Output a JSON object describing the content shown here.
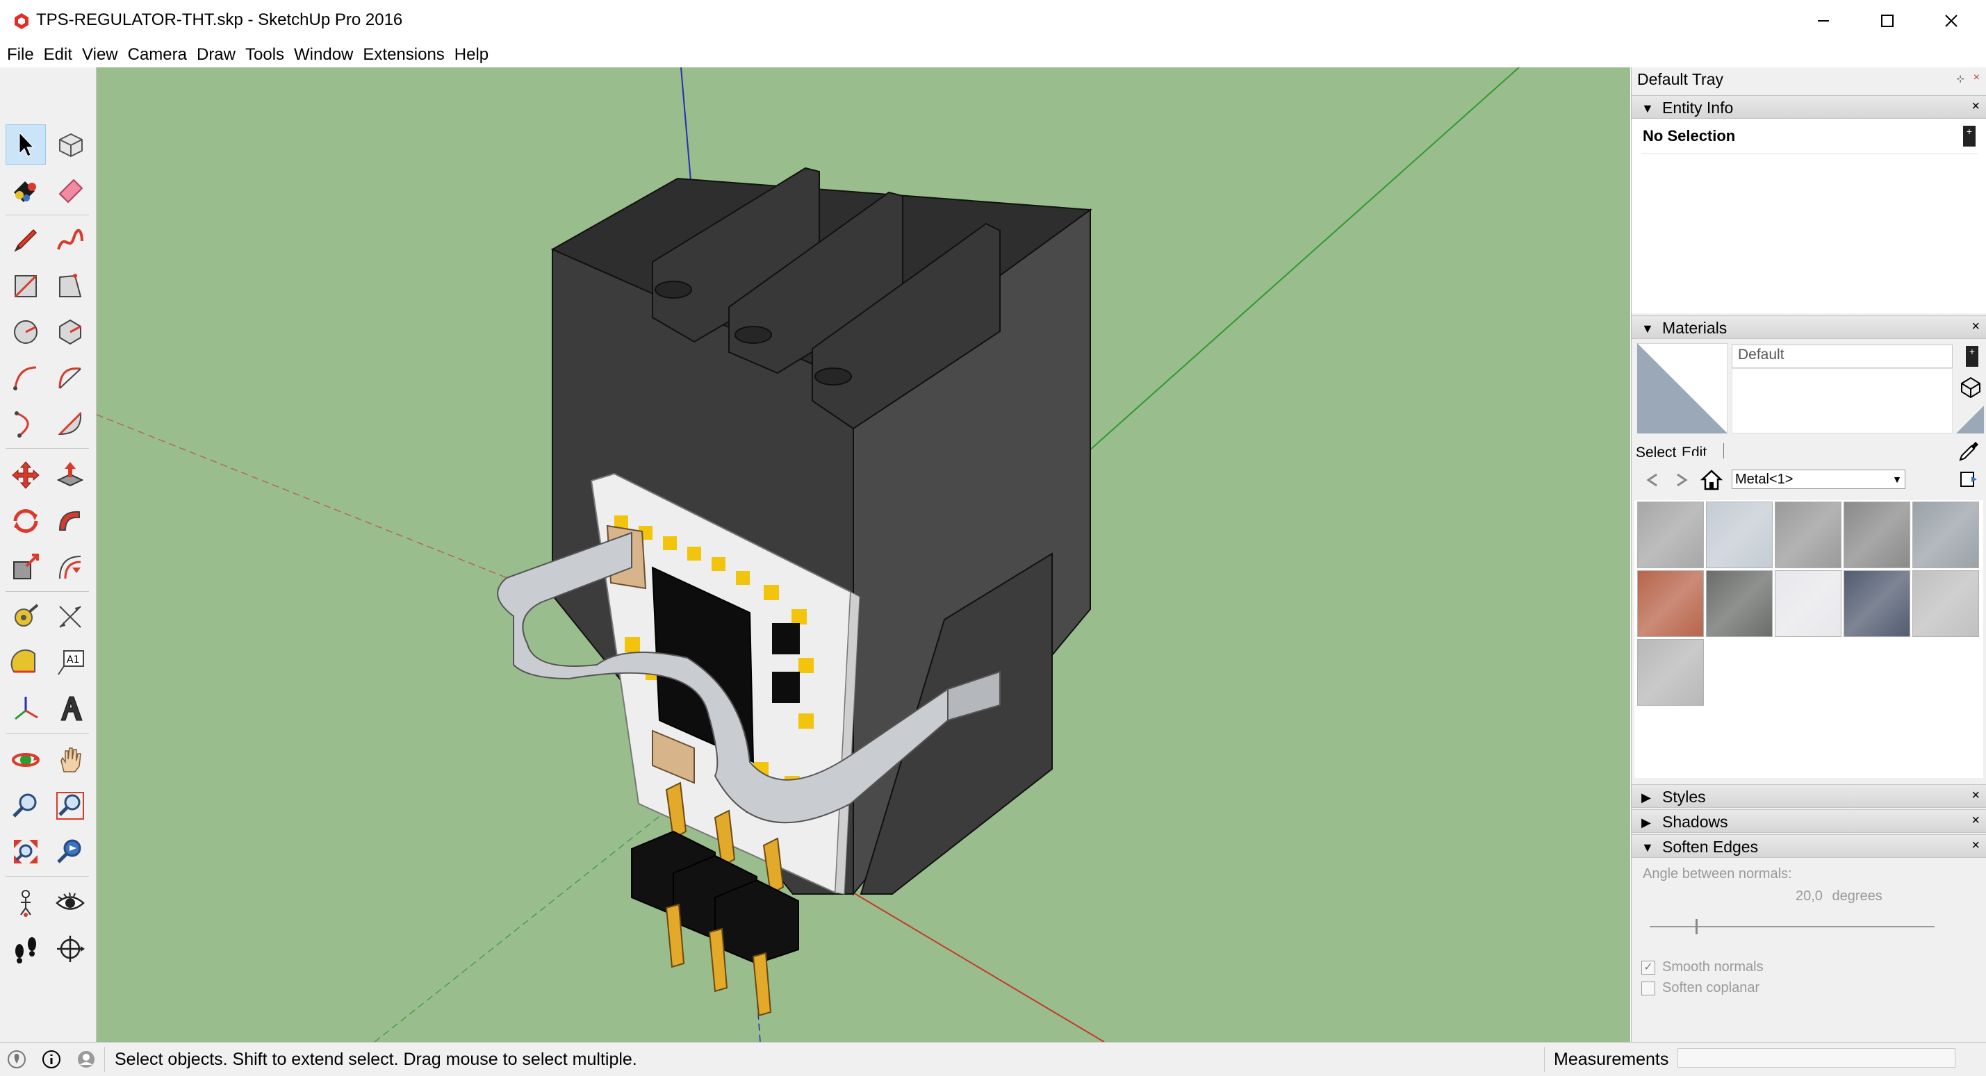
{
  "window": {
    "title": "TPS-REGULATOR-THT.skp - SketchUp Pro 2016",
    "controls": [
      "minimize-icon",
      "maximize-icon",
      "close-icon"
    ]
  },
  "menu": [
    "File",
    "Edit",
    "View",
    "Camera",
    "Draw",
    "Tools",
    "Window",
    "Extensions",
    "Help"
  ],
  "toolbar": {
    "tools": [
      "select",
      "make-component",
      "paint-bucket",
      "eraser",
      "line",
      "freehand",
      "rectangle",
      "rotated-rectangle",
      "circle",
      "polygon",
      "arc",
      "two-point-arc",
      "three-point-arc",
      "pie",
      "move",
      "push-pull",
      "rotate",
      "follow-me",
      "scale",
      "offset",
      "tape-measure",
      "dimension",
      "protractor",
      "text",
      "axes",
      "3d-text",
      "orbit",
      "pan",
      "zoom",
      "zoom-window",
      "zoom-extents",
      "previous-view",
      "position-camera",
      "look-around",
      "walk",
      "section-plane"
    ],
    "active_tool": "select"
  },
  "tray": {
    "title": "Default Tray",
    "entity_info": {
      "header": "Entity Info",
      "selection": "No Selection"
    },
    "materials": {
      "header": "Materials",
      "current_name": "Default",
      "tab_select": "Select",
      "tab_edit": "Edit",
      "library": "Metal<1>",
      "swatches": [
        {
          "name": "metal-brushed-gray",
          "color": "#a7a7a7"
        },
        {
          "name": "metal-light-blue",
          "color": "#c4ccd4"
        },
        {
          "name": "metal-cylinder-chrome",
          "color": "#9a9a9a"
        },
        {
          "name": "metal-diamond-plate",
          "color": "#8a8a8a"
        },
        {
          "name": "metal-gray-blue",
          "color": "#9aa2a8"
        },
        {
          "name": "metal-copper-rust",
          "color": "#b8644a"
        },
        {
          "name": "metal-dark-gray",
          "color": "#6a6d6a"
        },
        {
          "name": "metal-white",
          "color": "#e8e8ec"
        },
        {
          "name": "metal-blue-mesh",
          "color": "#525c70"
        },
        {
          "name": "metal-tread-plate",
          "color": "#c0c0c0"
        },
        {
          "name": "metal-light-gray",
          "color": "#b8b8b8"
        }
      ]
    },
    "styles": {
      "header": "Styles"
    },
    "shadows": {
      "header": "Shadows"
    },
    "soften_edges": {
      "header": "Soften Edges",
      "angle_label": "Angle between normals:",
      "angle_value": "20,0",
      "angle_unit": "degrees",
      "angle_slider_fraction": 0.16,
      "smooth_normals": {
        "label": "Smooth normals",
        "checked": true
      },
      "soften_coplanar": {
        "label": "Soften coplanar",
        "checked": false
      }
    }
  },
  "status": {
    "message": "Select objects. Shift to extend select. Drag mouse to select multiple.",
    "measurements_label": "Measurements",
    "measurements_value": ""
  },
  "colors": {
    "viewport_bg": "#9abd8e",
    "heatsink": "#3a3a3a",
    "pcb": "#eeeeee",
    "pads": "#f2c40b",
    "clip": "#c9ccd0",
    "axis_red": "#c43a2a",
    "axis_green": "#2f9a2f",
    "axis_blue": "#2b2bb0"
  }
}
